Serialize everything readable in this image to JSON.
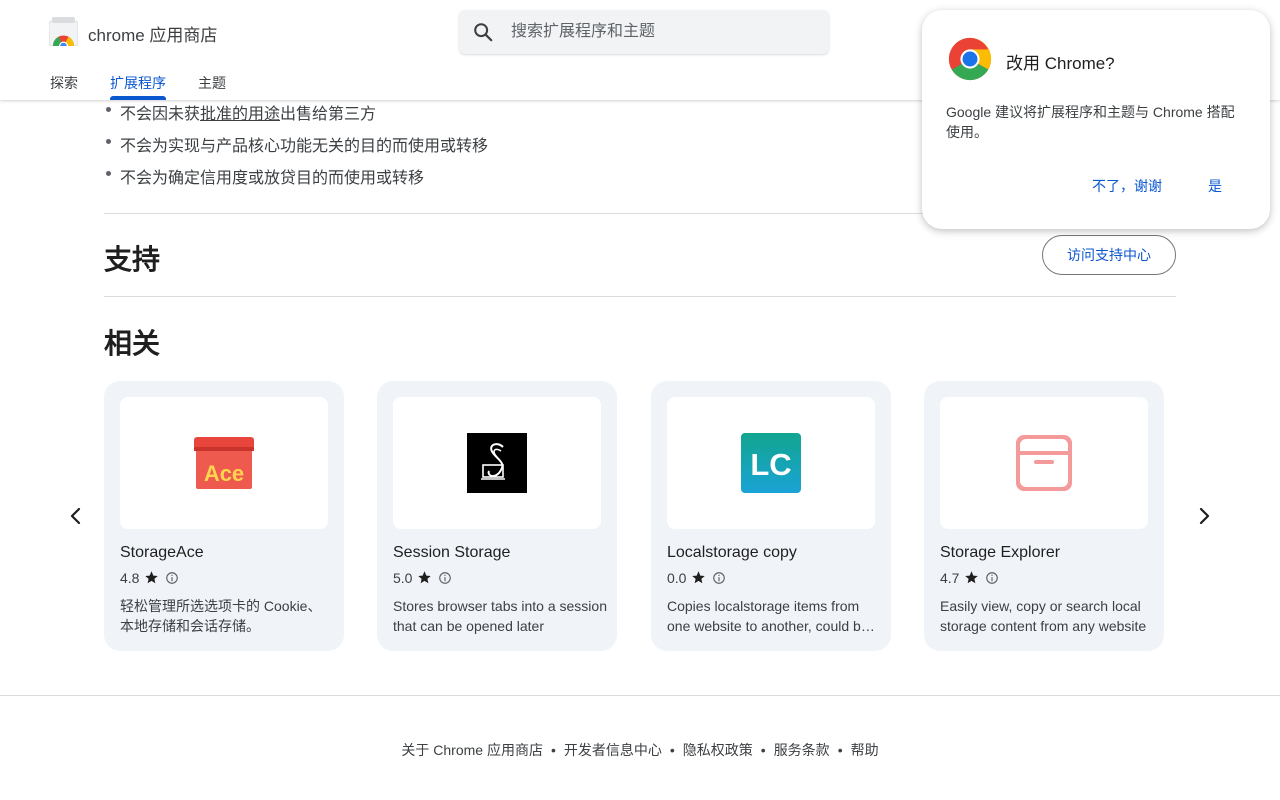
{
  "header": {
    "brand": "chrome 应用商店",
    "search_placeholder": "搜索扩展程序和主题",
    "tabs": [
      {
        "label": "探索",
        "active": false
      },
      {
        "label": "扩展程序",
        "active": true
      },
      {
        "label": "主题",
        "active": false
      }
    ]
  },
  "privacy_bullets": [
    {
      "pre": "不会因未获",
      "link": "批准的用途",
      "post": "出售给第三方"
    },
    {
      "pre": "不会为实现与产品核心功能无关的目的而使用或转移",
      "link": "",
      "post": ""
    },
    {
      "pre": "不会为确定信用度或放贷目的而使用或转移",
      "link": "",
      "post": ""
    }
  ],
  "support": {
    "title": "支持",
    "button_label": "访问支持中心"
  },
  "related": {
    "title": "相关",
    "items": [
      {
        "name": "StorageAce",
        "rating": "4.8",
        "description": "轻松管理所选选项卡的 Cookie、本地存储和会话存储。",
        "icon": "storageace-icon"
      },
      {
        "name": "Session Storage",
        "rating": "5.0",
        "description": "Stores browser tabs into a session that can be opened later",
        "icon": "session-storage-icon"
      },
      {
        "name": "Localstorage copy",
        "rating": "0.0",
        "description": "Copies localstorage items from one website to another, could be useful",
        "icon": "localstorage-copy-icon"
      },
      {
        "name": "Storage Explorer",
        "rating": "4.7",
        "description": "Easily view, copy or search local storage content from any website",
        "icon": "storage-explorer-icon"
      }
    ]
  },
  "footer": {
    "links": [
      "关于 Chrome 应用商店",
      "开发者信息中心",
      "隐私权政策",
      "服务条款",
      "帮助"
    ],
    "separator": "•"
  },
  "popup": {
    "title": "改用 Chrome?",
    "body": "Google 建议将扩展程序和主题与 Chrome 搭配使用。",
    "decline_label": "不了，谢谢",
    "accept_label": "是"
  },
  "colors": {
    "accent": "#0b57d0",
    "card_bg": "#f0f4f9",
    "divider": "#dadce0"
  }
}
